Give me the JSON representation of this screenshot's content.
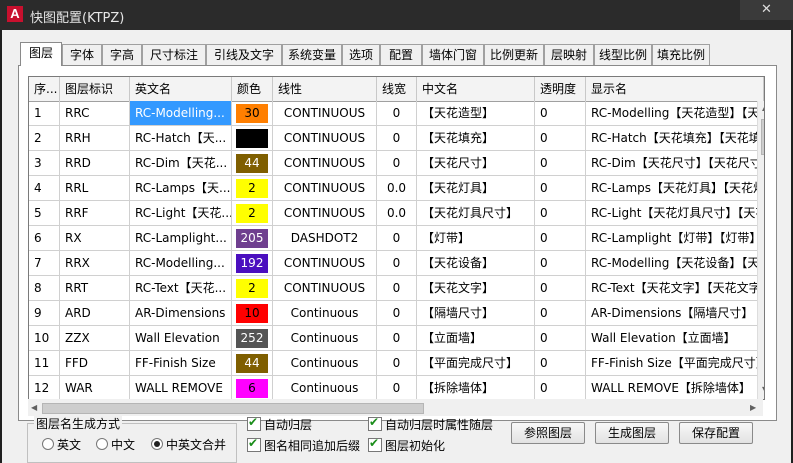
{
  "window": {
    "title": "快图配置(KTPZ)",
    "close_label": "✕",
    "icon_letter": "A"
  },
  "tabs": [
    {
      "label": "图层",
      "active": true
    },
    {
      "label": "字体"
    },
    {
      "label": "字高"
    },
    {
      "label": "尺寸标注"
    },
    {
      "label": "引线及文字"
    },
    {
      "label": "系统变量"
    },
    {
      "label": "选项"
    },
    {
      "label": "配置"
    },
    {
      "label": "墙体门窗"
    },
    {
      "label": "比例更新"
    },
    {
      "label": "层映射"
    },
    {
      "label": "线型比例"
    },
    {
      "label": "填充比例"
    }
  ],
  "table": {
    "columns": [
      "序...",
      "图层标识",
      "英文名",
      "颜色",
      "线性",
      "线宽",
      "中文名",
      "透明度",
      "显示名"
    ],
    "rows": [
      {
        "seq": "1",
        "id": "RRC",
        "en": "RC-Modelling...",
        "color": "30",
        "color_hex": "#ff7f00",
        "ltype": "CONTINUOUS",
        "lw": "0",
        "cn": "【天花造型】",
        "trans": "0",
        "display": "RC-Modelling【天花造型】【天花造型】",
        "selected": true
      },
      {
        "seq": "2",
        "id": "RRH",
        "en": "RC-Hatch【天...",
        "color": "",
        "color_hex": "#000000",
        "ltype": "CONTINUOUS",
        "lw": "0",
        "cn": "【天花填充】",
        "trans": "0",
        "display": "RC-Hatch【天花填充】【天花填充】"
      },
      {
        "seq": "3",
        "id": "RRD",
        "en": "RC-Dim【天花...",
        "color": "44",
        "color_hex": "#7f5f00",
        "ltype": "CONTINUOUS",
        "lw": "0",
        "cn": "【天花尺寸】",
        "trans": "0",
        "display": "RC-Dim【天花尺寸】【天花尺寸】"
      },
      {
        "seq": "4",
        "id": "RRL",
        "en": "RC-Lamps【天...",
        "color": "2",
        "color_hex": "#ffff00",
        "ltype": "CONTINUOUS",
        "lw": "0.0",
        "cn": "【天花灯具】",
        "trans": "0",
        "display": "RC-Lamps【天花灯具】【天花灯具】"
      },
      {
        "seq": "5",
        "id": "RRF",
        "en": "RC-Light【天花...",
        "color": "2",
        "color_hex": "#ffff00",
        "ltype": "CONTINUOUS",
        "lw": "0.0",
        "cn": "【天花灯具尺寸】",
        "trans": "0",
        "display": "RC-Light【天花灯具尺寸】【天花灯具尺寸】"
      },
      {
        "seq": "6",
        "id": "RX",
        "en": "RC-Lamplight...",
        "color": "205",
        "color_hex": "#6f3f8f",
        "ltype": "DASHDOT2",
        "lw": "0",
        "cn": "【灯带】",
        "trans": "0",
        "display": "RC-Lamplight【灯带】【灯带】"
      },
      {
        "seq": "7",
        "id": "RRX",
        "en": "RC-Modelling...",
        "color": "192",
        "color_hex": "#4b0fbf",
        "ltype": "CONTINUOUS",
        "lw": "0",
        "cn": "【天花设备】",
        "trans": "0",
        "display": "RC-Modelling【天花设备】【天花设备】"
      },
      {
        "seq": "8",
        "id": "RRT",
        "en": "RC-Text【天花...",
        "color": "2",
        "color_hex": "#ffff00",
        "ltype": "CONTINUOUS",
        "lw": "0",
        "cn": "【天花文字】",
        "trans": "0",
        "display": "RC-Text【天花文字】【天花文字】"
      },
      {
        "seq": "9",
        "id": "ARD",
        "en": "AR-Dimensions",
        "color": "10",
        "color_hex": "#ff0000",
        "ltype": "Continuous",
        "lw": "0",
        "cn": "【隔墙尺寸】",
        "trans": "0",
        "display": "AR-Dimensions【隔墙尺寸】"
      },
      {
        "seq": "10",
        "id": "ZZX",
        "en": "Wall Elevation",
        "color": "252",
        "color_hex": "#555555",
        "ltype": "Continuous",
        "lw": "0",
        "cn": "【立面墙】",
        "trans": "0",
        "display": "Wall Elevation【立面墙】"
      },
      {
        "seq": "11",
        "id": "FFD",
        "en": "FF-Finish Size",
        "color": "44",
        "color_hex": "#7f5f00",
        "ltype": "Continuous",
        "lw": "0",
        "cn": "【平面完成尺寸】",
        "trans": "0",
        "display": "FF-Finish Size【平面完成尺寸】"
      },
      {
        "seq": "12",
        "id": "WAR",
        "en": "WALL REMOVE",
        "color": "6",
        "color_hex": "#ff00ff",
        "ltype": "Continuous",
        "lw": "0",
        "cn": "【拆除墙体】",
        "trans": "0",
        "display": "WALL REMOVE【拆除墙体】"
      }
    ]
  },
  "name_mode": {
    "title": "图层名生成方式",
    "options": [
      {
        "label": "英文",
        "selected": false
      },
      {
        "label": "中文",
        "selected": false
      },
      {
        "label": "中英文合并",
        "selected": true
      }
    ]
  },
  "checkboxes": [
    {
      "label": "自动归层",
      "checked": true
    },
    {
      "label": "自动归层时属性随层",
      "checked": true
    },
    {
      "label": "图名相同追加后缀",
      "checked": true
    },
    {
      "label": "图层初始化",
      "checked": true
    }
  ],
  "buttons": {
    "ref_layer": "参照图层",
    "gen_layer": "生成图层",
    "save_config": "保存配置"
  }
}
